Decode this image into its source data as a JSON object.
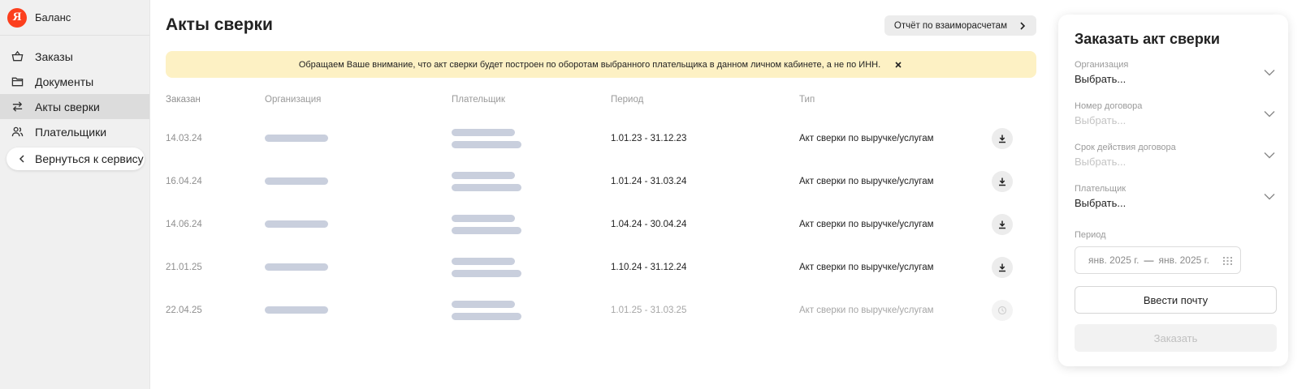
{
  "sidebar": {
    "brand_logo": "Я",
    "brand_name": "Баланс",
    "items": [
      {
        "label": "Заказы",
        "icon": "basket-icon"
      },
      {
        "label": "Документы",
        "icon": "folder-icon"
      },
      {
        "label": "Акты сверки",
        "icon": "arrows-swap-icon",
        "active": true
      },
      {
        "label": "Плательщики",
        "icon": "users-icon"
      }
    ],
    "back_label": "Вернуться к сервису"
  },
  "main": {
    "title": "Акты сверки",
    "report_button": "Отчёт по взаиморасчетам",
    "notice": "Обращаем Ваше внимание, что акт сверки будет построен по оборотам выбранного плательщика в данном личном кабинете, а не по ИНН.",
    "table": {
      "headers": [
        "Заказан",
        "Организация",
        "Плательщик",
        "Период",
        "Тип"
      ],
      "rows": [
        {
          "date": "14.03.24",
          "period": "1.01.23 - 31.12.23",
          "type": "Акт сверки по выручке/услугам",
          "status": "download"
        },
        {
          "date": "16.04.24",
          "period": "1.01.24 - 31.03.24",
          "type": "Акт сверки по выручке/услугам",
          "status": "download"
        },
        {
          "date": "14.06.24",
          "period": "1.04.24 - 30.04.24",
          "type": "Акт сверки по выручке/услугам",
          "status": "download"
        },
        {
          "date": "21.01.25",
          "period": "1.10.24 - 31.12.24",
          "type": "Акт сверки по выручке/услугам",
          "status": "download"
        },
        {
          "date": "22.04.25",
          "period": "1.01.25 - 31.03.25",
          "type": "Акт сверки по выручке/услугам",
          "status": "pending"
        }
      ]
    }
  },
  "panel": {
    "title": "Заказать акт сверки",
    "fields": [
      {
        "label": "Организация",
        "value": "Выбрать...",
        "placeholder": false
      },
      {
        "label": "Номер договора",
        "value": "Выбрать...",
        "placeholder": true
      },
      {
        "label": "Срок действия договора",
        "value": "Выбрать...",
        "placeholder": true
      },
      {
        "label": "Плательщик",
        "value": "Выбрать...",
        "placeholder": false
      }
    ],
    "period_label": "Период",
    "period_from": "янв. 2025 г.",
    "period_sep": "—",
    "period_to": "янв. 2025 г.",
    "email_button": "Ввести почту",
    "order_button": "Заказать"
  },
  "colors": {
    "brand": "#fc3f1d",
    "notice_bg": "#fdf1c4",
    "skeleton": "#c9cfdd",
    "sidebar_bg": "#f0f0f0"
  }
}
